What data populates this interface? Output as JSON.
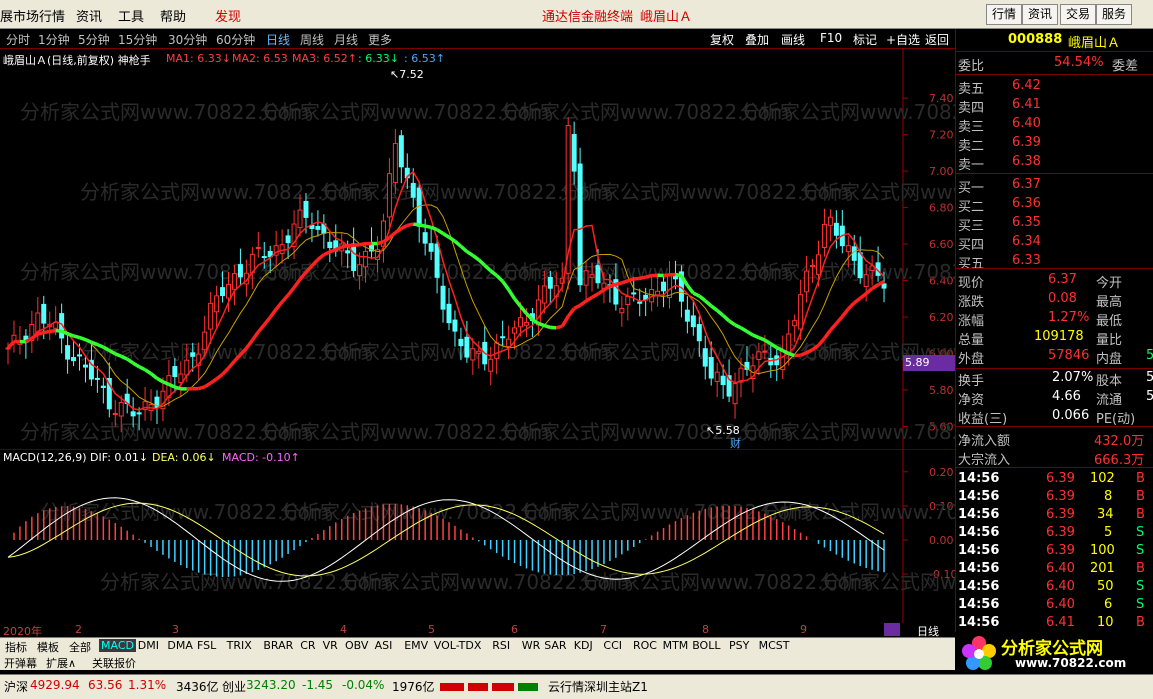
{
  "menu": {
    "items": [
      "展市场行情",
      "资讯",
      "工具",
      "帮助",
      "发现"
    ],
    "center_links": [
      "通达信金融终端",
      "峨眉山Ａ"
    ],
    "right_buttons": [
      "行情",
      "资讯",
      "交易",
      "服务"
    ]
  },
  "periods": [
    "分时",
    "1分钟",
    "5分钟",
    "15分钟",
    "30分钟",
    "60分钟",
    "日线",
    "周线",
    "月线",
    "更多"
  ],
  "active_period": "日线",
  "tools": [
    "复权",
    "叠加",
    "画线",
    "F10",
    "标记",
    "+自选",
    "返回"
  ],
  "chart_header": {
    "title": "峨眉山Ａ(日线,前复权) 神枪手",
    "ma1": "MA1: 6.33↓",
    "ma2": "MA2: 6.53",
    "ma3": "MA3: 6.52↑",
    "ma4": ": 6.33↓",
    "ma5": ": 6.53↑"
  },
  "annotations": {
    "high": "7.52",
    "low": "5.58",
    "cai": "财",
    "price_tag": "5.89"
  },
  "watermark": "分析家公式网www.70822.Com",
  "macd_header": {
    "name": "MACD(12,26,9)",
    "dif": "DIF: 0.01↓",
    "dea": "DEA: 0.06↓",
    "macd": "MACD: -0.10↑"
  },
  "date_axis": [
    "2020年",
    "2",
    "3",
    "4",
    "5",
    "6",
    "7",
    "8",
    "9"
  ],
  "period_label": "日线",
  "chart_data": [
    {
      "type": "candlestick",
      "title": "峨眉山Ａ(日线,前复权)",
      "y_ticks": [
        "7.40",
        "7.20",
        "7.00",
        "6.80",
        "6.60",
        "6.40",
        "6.20",
        "6.00",
        "5.80",
        "5.60"
      ],
      "ylim": [
        5.52,
        7.56
      ],
      "close_approx": [
        6.0,
        6.1,
        6.2,
        6.15,
        6.05,
        5.95,
        5.85,
        5.75,
        5.7,
        5.65,
        5.75,
        5.8,
        5.9,
        6.0,
        6.2,
        6.35,
        6.45,
        6.5,
        6.55,
        6.6,
        6.7,
        6.75,
        6.65,
        6.55,
        6.5,
        6.55,
        6.6,
        7.2,
        6.9,
        6.6,
        6.4,
        6.1,
        5.98,
        6.0,
        6.02,
        6.1,
        6.2,
        6.28,
        6.38,
        6.4,
        6.38,
        6.42,
        6.35,
        6.25,
        6.3,
        6.35,
        6.4,
        6.28,
        6.1,
        5.85,
        5.8,
        5.9,
        5.95,
        5.98,
        6.0,
        6.25,
        6.5,
        6.75,
        6.6,
        6.5,
        6.45,
        6.37
      ],
      "series": [
        {
          "name": "MA1",
          "color": "#ff3030"
        },
        {
          "name": "MA2",
          "color": "#ff3030"
        },
        {
          "name": "MA3",
          "color": "#ff2020"
        }
      ]
    },
    {
      "type": "bar",
      "title": "MACD(12,26,9)",
      "y_ticks": [
        "0.20",
        "0.10",
        "0.00",
        "-0.10"
      ],
      "ylim": [
        -0.22,
        0.22
      ],
      "series": [
        {
          "name": "DIF",
          "color": "#ffffff"
        },
        {
          "name": "DEA",
          "color": "#ffff66"
        },
        {
          "name": "MACD",
          "color": "#ff66ff"
        }
      ]
    }
  ],
  "quote": {
    "code": "000888",
    "name": "峨眉山Ａ",
    "weibi_label": "委比",
    "weibi": "54.54%",
    "weicha_label": "委差",
    "sell": [
      {
        "label": "卖五",
        "price": "6.42"
      },
      {
        "label": "卖四",
        "price": "6.41"
      },
      {
        "label": "卖三",
        "price": "6.40"
      },
      {
        "label": "卖二",
        "price": "6.39"
      },
      {
        "label": "卖一",
        "price": "6.38"
      }
    ],
    "buy": [
      {
        "label": "买一",
        "price": "6.37"
      },
      {
        "label": "买二",
        "price": "6.36"
      },
      {
        "label": "买三",
        "price": "6.35"
      },
      {
        "label": "买四",
        "price": "6.34"
      },
      {
        "label": "买五",
        "price": "6.33"
      }
    ],
    "stats": [
      {
        "l": "现价",
        "v": "6.37",
        "l2": "今开",
        "v2": ""
      },
      {
        "l": "涨跌",
        "v": "0.08",
        "l2": "最高",
        "v2": ""
      },
      {
        "l": "涨幅",
        "v": "1.27%",
        "l2": "最低",
        "v2": ""
      },
      {
        "l": "总量",
        "v": "109178",
        "l2": "量比",
        "v2": ""
      },
      {
        "l": "外盘",
        "v": "57846",
        "l2": "内盘",
        "v2": "5"
      }
    ],
    "stats2": [
      {
        "l": "换手",
        "v": "2.07%",
        "l2": "股本",
        "v2": "5."
      },
      {
        "l": "净资",
        "v": "4.66",
        "l2": "流通",
        "v2": "5."
      },
      {
        "l": "收益(三)",
        "v": "0.066",
        "l2": "PE(动)",
        "v2": ""
      }
    ],
    "netflow_label": "净流入额",
    "netflow": "432.0万",
    "bigflow_label": "大宗流入",
    "bigflow": "666.3万",
    "ticks": [
      {
        "t": "14:56",
        "p": "6.39",
        "v": "102",
        "d": "B"
      },
      {
        "t": "14:56",
        "p": "6.39",
        "v": "8",
        "d": "B"
      },
      {
        "t": "14:56",
        "p": "6.39",
        "v": "34",
        "d": "B"
      },
      {
        "t": "14:56",
        "p": "6.39",
        "v": "5",
        "d": "S"
      },
      {
        "t": "14:56",
        "p": "6.39",
        "v": "100",
        "d": "S"
      },
      {
        "t": "14:56",
        "p": "6.40",
        "v": "201",
        "d": "B"
      },
      {
        "t": "14:56",
        "p": "6.40",
        "v": "50",
        "d": "S"
      },
      {
        "t": "14:56",
        "p": "6.40",
        "v": "6",
        "d": "S"
      },
      {
        "t": "14:56",
        "p": "6.41",
        "v": "10",
        "d": "B"
      }
    ]
  },
  "tabs": [
    "指标",
    "模板",
    "全部",
    "MACD",
    "DMI",
    "DMA",
    "FSL",
    "TRIX",
    "BRAR",
    "CR",
    "VR",
    "OBV",
    "ASI",
    "EMV",
    "VOL-TDX",
    "RSI",
    "WR",
    "SAR",
    "KDJ",
    "CCI",
    "ROC",
    "MTM",
    "BOLL",
    "PSY",
    "MCST"
  ],
  "selected_tab": "MACD",
  "tabs2": [
    "开弹幕",
    "扩展∧",
    "关联报价"
  ],
  "status": {
    "sh_label": "沪深",
    "sh_val": "4929.94",
    "sh_chg": "63.56",
    "sh_pct": "1.31%",
    "sh_amt": "3436亿",
    "cy_label": "创业",
    "cy_val": "3243.20",
    "cy_chg": "-1.45",
    "cy_pct": "-0.04%",
    "cy_amt": "1976亿",
    "server": "云行情深圳主站Z1"
  },
  "logo": {
    "text": "分析家公式网",
    "url": "www.70822.com"
  }
}
